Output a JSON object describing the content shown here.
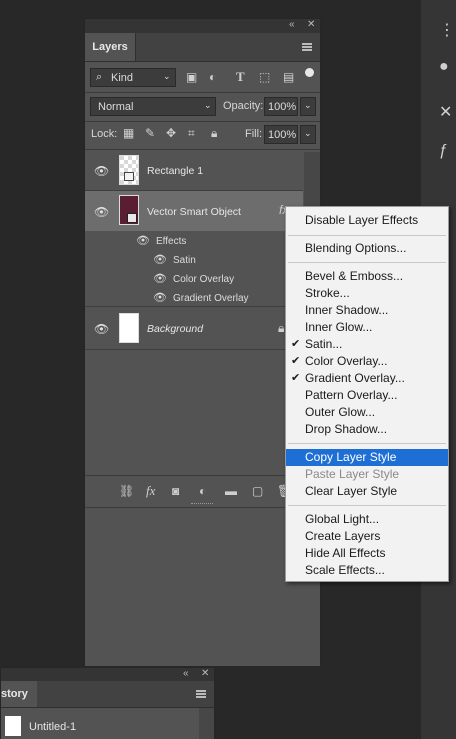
{
  "layers_panel": {
    "tab_label": "Layers",
    "filter": {
      "kind_label": "Kind"
    },
    "blend_mode": "Normal",
    "opacity_label": "Opacity:",
    "opacity_value": "100%",
    "lock_label": "Lock:",
    "fill_label": "Fill:",
    "fill_value": "100%",
    "layers": [
      {
        "name": "Rectangle 1"
      },
      {
        "name": "Vector Smart Object",
        "fx": "fx"
      },
      {
        "name": "Background"
      }
    ],
    "effects": {
      "header": "Effects",
      "items": [
        "Satin",
        "Color Overlay",
        "Gradient Overlay"
      ]
    },
    "bottom_fx": "fx"
  },
  "context_menu": {
    "items": [
      {
        "label": "Disable Layer Effects"
      },
      {
        "label": "Blending Options..."
      },
      {
        "label": "Bevel & Emboss..."
      },
      {
        "label": "Stroke..."
      },
      {
        "label": "Inner Shadow..."
      },
      {
        "label": "Inner Glow..."
      },
      {
        "label": "Satin...",
        "checked": true
      },
      {
        "label": "Color Overlay...",
        "checked": true
      },
      {
        "label": "Gradient Overlay...",
        "checked": true
      },
      {
        "label": "Pattern Overlay..."
      },
      {
        "label": "Outer Glow..."
      },
      {
        "label": "Drop Shadow..."
      },
      {
        "label": "Copy Layer Style",
        "highlighted": true
      },
      {
        "label": "Paste Layer Style",
        "disabled": true
      },
      {
        "label": "Clear Layer Style"
      },
      {
        "label": "Global Light..."
      },
      {
        "label": "Create Layers"
      },
      {
        "label": "Hide All Effects"
      },
      {
        "label": "Scale Effects..."
      }
    ]
  },
  "history_panel": {
    "tab_label": "story",
    "items": [
      {
        "label": "Untitled-1"
      }
    ]
  },
  "colors": {
    "highlight": "#1e6fd5",
    "panel": "#535353",
    "thumb_wine": "#5a1e33"
  }
}
